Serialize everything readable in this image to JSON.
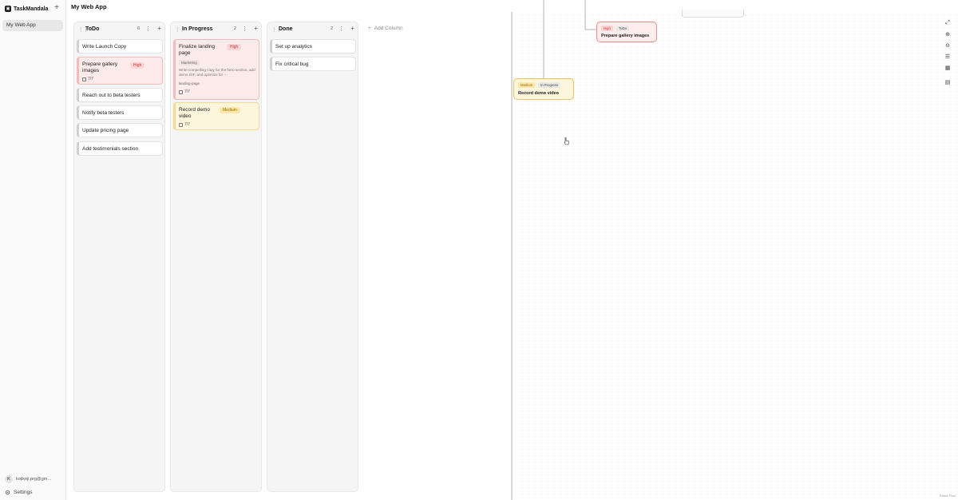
{
  "sidebar": {
    "brand_icon": "app-logo-icon",
    "brand": "TaskMandala",
    "add_project": "+",
    "projects": [
      "My Web App"
    ],
    "user_initial": "K",
    "user_email": "kojikoji.prg@gm…",
    "settings": "Settings"
  },
  "header": {
    "title": "My Web App"
  },
  "board": {
    "columns": [
      {
        "title": "ToDo",
        "count": "6",
        "cards": [
          {
            "title": "Write Launch Copy"
          },
          {
            "title": "Prepare gallery images",
            "priority": "High",
            "date": "7/7"
          },
          {
            "title": "Reach out to beta testers"
          },
          {
            "title": "Notify beta testers"
          },
          {
            "title": "Update pricing page"
          },
          {
            "title": "Add testimonials section"
          }
        ]
      },
      {
        "title": "In Progress",
        "count": "2",
        "cards": [
          {
            "title": "Finalize landing page",
            "priority": "High",
            "tag": "Marketing",
            "description": "Write compelling copy for the hero section, add demo GIF, and optimize for ···",
            "tag2": "landing-page",
            "date": "7/7"
          },
          {
            "title": "Record demo video",
            "priority": "Medium",
            "date": "7/7"
          }
        ]
      },
      {
        "title": "Done",
        "count": "2",
        "cards": [
          {
            "title": "Set up analytics"
          },
          {
            "title": "Fix critical bug"
          }
        ]
      }
    ],
    "add_column": "Add Column"
  },
  "flow": {
    "nodes": [
      {
        "priority": "High",
        "status": "ToDo",
        "title": "Prepare gallery images"
      },
      {
        "priority": "Medium",
        "status": "In Progress",
        "title": "Record demo video"
      }
    ],
    "controls": [
      "fullscreen-icon",
      "zoom-in-icon",
      "zoom-out-icon",
      "layout-icon",
      "grid-icon",
      "export-icon"
    ],
    "attribution": "React Flow"
  },
  "colors": {
    "high_bg": "#fdebeb",
    "high_border": "#f3bcbc",
    "high_text": "#cc3535",
    "medium_bg": "#fdf6dc",
    "medium_border": "#f2db93",
    "medium_text": "#9a6d00"
  }
}
